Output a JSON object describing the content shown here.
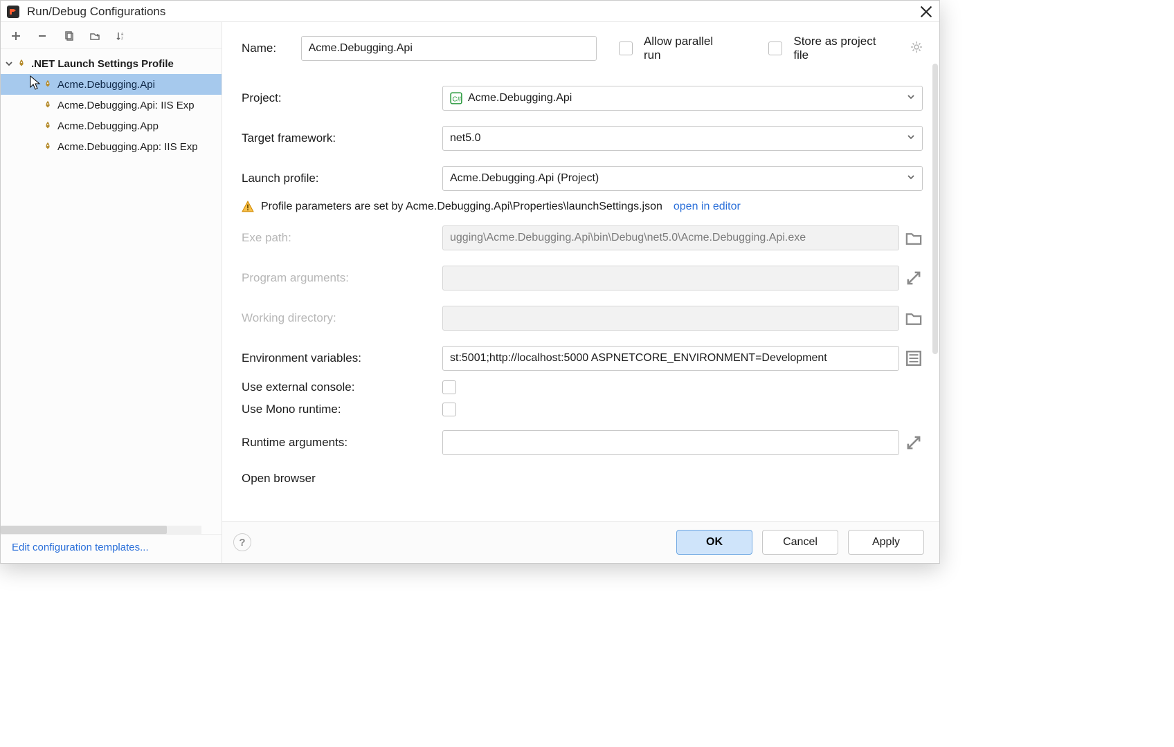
{
  "titlebar": {
    "title": "Run/Debug Configurations"
  },
  "sidebar": {
    "group": ".NET Launch Settings Profile",
    "items": [
      "Acme.Debugging.Api",
      "Acme.Debugging.Api: IIS Exp",
      "Acme.Debugging.App",
      "Acme.Debugging.App: IIS Exp"
    ],
    "templates_link": "Edit configuration templates..."
  },
  "topline": {
    "name_label": "Name:",
    "name_value": "Acme.Debugging.Api",
    "allow_parallel": "Allow parallel run",
    "store_as_file": "Store as project file"
  },
  "form": {
    "project_label": "Project:",
    "project_value": "Acme.Debugging.Api",
    "tf_label": "Target framework:",
    "tf_value": "net5.0",
    "lp_label": "Launch profile:",
    "lp_value": "Acme.Debugging.Api (Project)",
    "warning_text": "Profile parameters are set by Acme.Debugging.Api\\Properties\\launchSettings.json",
    "warning_link": "open in editor",
    "exe_label": "Exe path:",
    "exe_value": "ugging\\Acme.Debugging.Api\\bin\\Debug\\net5.0\\Acme.Debugging.Api.exe",
    "args_label": "Program arguments:",
    "args_value": "",
    "wd_label": "Working directory:",
    "wd_value": "",
    "env_label": "Environment variables:",
    "env_value": "st:5001;http://localhost:5000 ASPNETCORE_ENVIRONMENT=Development",
    "ext_console_label": "Use external console:",
    "mono_label": "Use Mono runtime:",
    "runtime_args_label": "Runtime arguments:",
    "runtime_args_value": "",
    "open_browser": "Open browser"
  },
  "buttons": {
    "ok": "OK",
    "cancel": "Cancel",
    "apply": "Apply"
  },
  "help_glyph": "?"
}
